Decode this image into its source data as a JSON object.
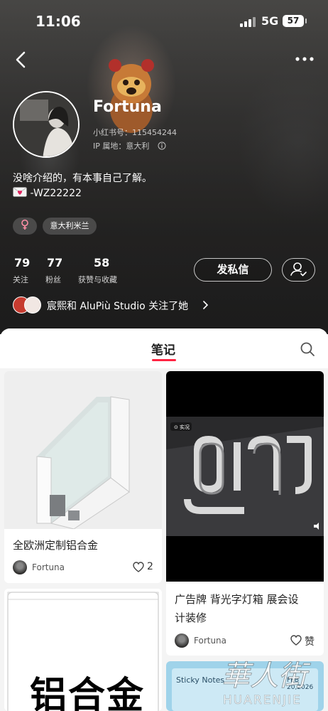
{
  "status_bar": {
    "time": "11:06",
    "network": "5G",
    "battery": "57"
  },
  "profile": {
    "nickname": "Fortuna",
    "redbook_id": "小红书号：115454244",
    "ip_location": "IP 属地：意大利",
    "bio_line1": "没啥介绍的，有本事自己了解。",
    "bio_line2": "-WZ22222",
    "location_tag": "意大利米兰"
  },
  "stats": [
    {
      "value": "79",
      "label": "关注"
    },
    {
      "value": "77",
      "label": "粉丝"
    },
    {
      "value": "58",
      "label": "获赞与收藏"
    }
  ],
  "actions": {
    "message_label": "发私信"
  },
  "followed_by": {
    "text": "宸熙和 AluPiù Studio 关注了她"
  },
  "tabs": {
    "notes": "笔记"
  },
  "notes": [
    {
      "title": "全欧洲定制铝合金",
      "author": "Fortuna",
      "likes": "2"
    },
    {
      "title": "广告牌 背光字灯箱 展会设计装修",
      "title_line1": "广告牌 背光字灯箱 展会设",
      "title_line2": "计装修",
      "author": "Fortuna",
      "likes": "赞",
      "live_badge": "实况"
    },
    {
      "title": "铝合金"
    },
    {
      "title": "Sticky Notes",
      "date": "FEB 20,2026"
    }
  ],
  "colors": {
    "accent": "#ff2442",
    "hero_bg": "#3a3938"
  },
  "watermark": {
    "text_cn": "華人街",
    "text_en": "HUARENJIE"
  }
}
